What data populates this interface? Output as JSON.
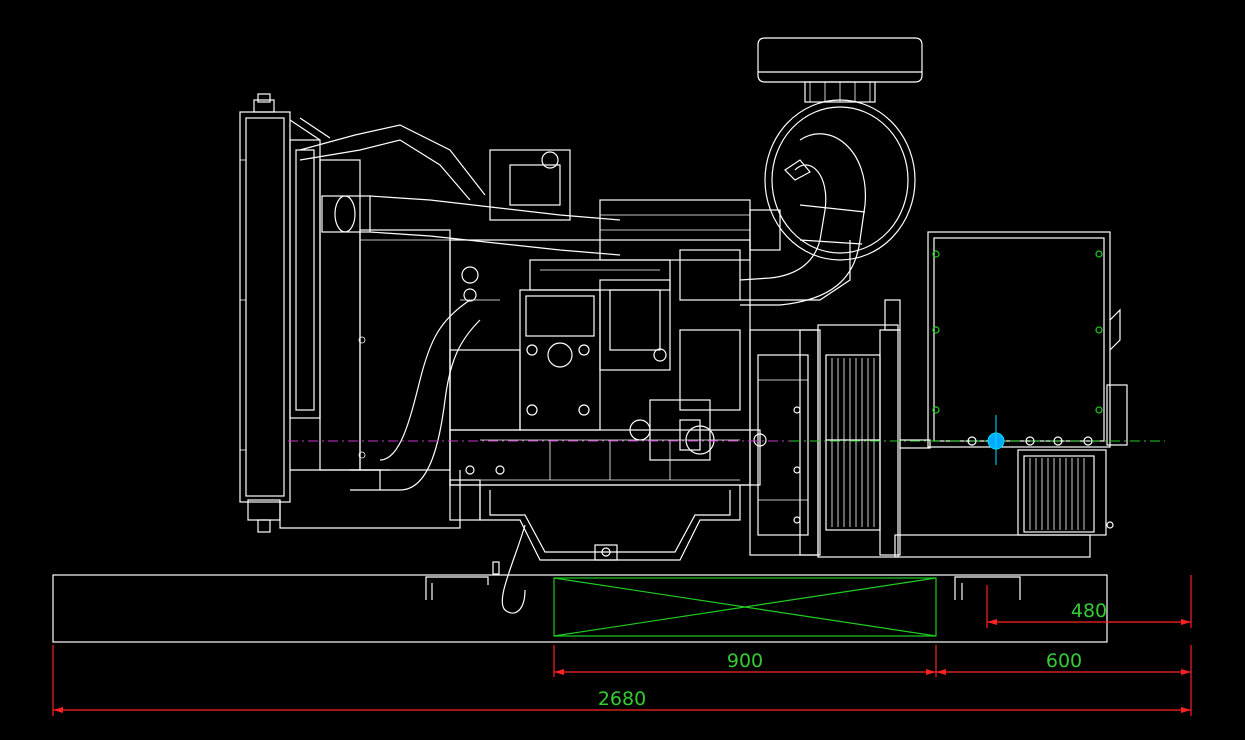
{
  "drawing": {
    "colors": {
      "background": "#000000",
      "outline": "#ffffff",
      "dimension_line": "#ff2222",
      "dimension_text": "#33cc33",
      "center_line_engine": "#cc33cc",
      "center_line_alternator": "#22cc22",
      "alternator_marker": "#00aaff"
    },
    "dimensions": {
      "overall_length": "2680",
      "support_span": "900",
      "end_offset": "600",
      "rail_offset": "480"
    }
  }
}
